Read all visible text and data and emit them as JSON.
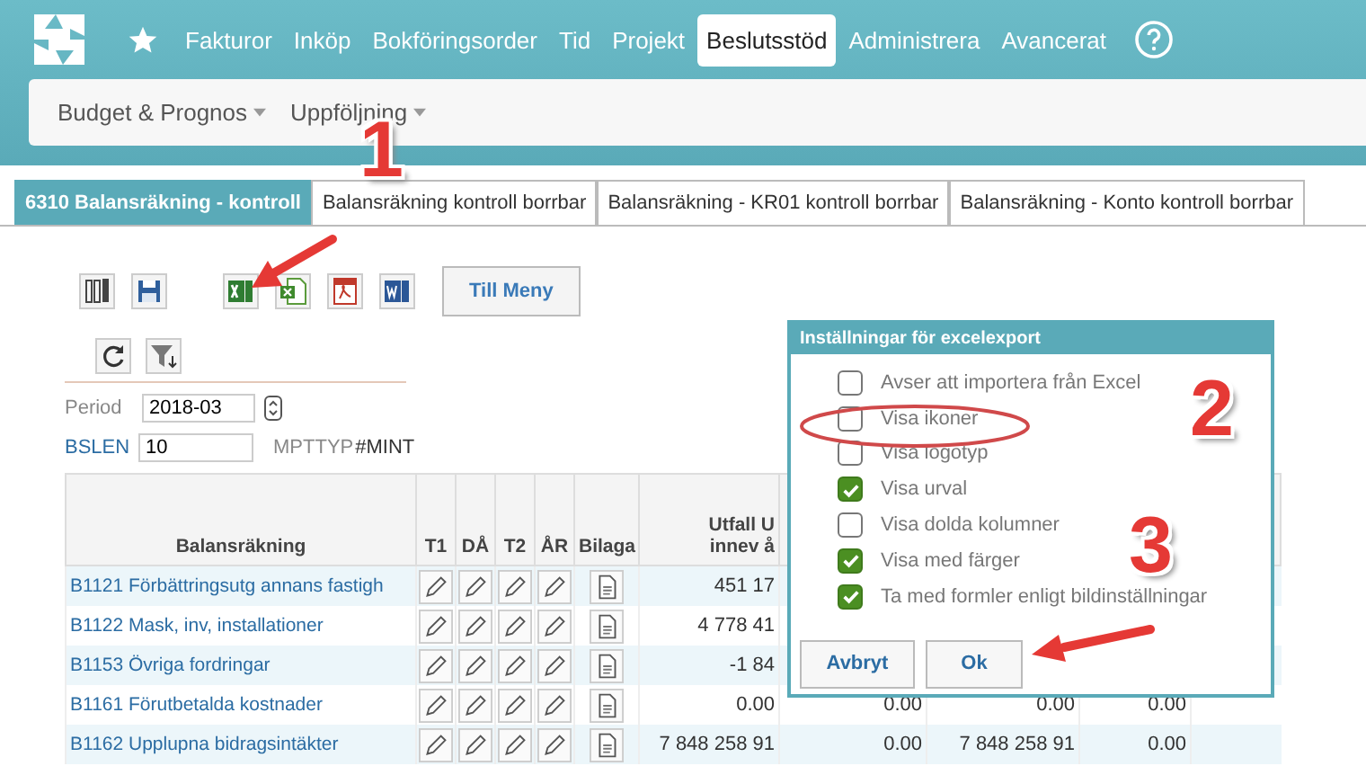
{
  "nav": {
    "items": [
      {
        "label": "Fakturor",
        "selected": false
      },
      {
        "label": "Inköp",
        "selected": false
      },
      {
        "label": "Bokföringsorder",
        "selected": false
      },
      {
        "label": "Tid",
        "selected": false
      },
      {
        "label": "Projekt",
        "selected": false
      },
      {
        "label": "Beslutsstöd",
        "selected": true
      },
      {
        "label": "Administrera",
        "selected": false
      },
      {
        "label": "Avancerat",
        "selected": false
      }
    ]
  },
  "subnav": {
    "items": [
      "Budget & Prognos",
      "Uppföljning"
    ]
  },
  "tabs": [
    {
      "label": "6310 Balansräkning - kontroll",
      "selected": true
    },
    {
      "label": "Balansräkning kontroll borrbar",
      "selected": false
    },
    {
      "label": "Balansräkning - KR01 kontroll borrbar",
      "selected": false
    },
    {
      "label": "Balansräkning - Konto kontroll borrbar",
      "selected": false
    }
  ],
  "toolbar": {
    "menu_button": "Till Meny"
  },
  "filters": {
    "period_label": "Period",
    "period_value": "2018-03",
    "bslen_label": "BSLEN",
    "bslen_value": "10",
    "mpttyp_label": "MPTTYP",
    "mpttyp_value": "#MINT"
  },
  "table": {
    "columns": [
      "Balansräkning",
      "T1",
      "DÅ",
      "T2",
      "ÅR",
      "Bilaga"
    ],
    "column_7": [
      "Utfall U",
      "innev å"
    ],
    "rows": [
      {
        "account": "B1121 Förbättringsutg annans fastigh",
        "values": [
          "451 17"
        ]
      },
      {
        "account": "B1122 Mask, inv, installationer",
        "values": [
          "4 778 41"
        ]
      },
      {
        "account": "B1153 Övriga fordringar",
        "values": [
          "-1 84"
        ]
      },
      {
        "account": "B1161 Förutbetalda kostnader",
        "values": [
          "0.00",
          "0.00",
          "0.00",
          "0.00"
        ]
      },
      {
        "account": "B1162 Upplupna bidragsintäkter",
        "values": [
          "7 848 258 91",
          "0.00",
          "7 848 258 91",
          "0.00"
        ]
      }
    ]
  },
  "dialog": {
    "title": "Inställningar för excelexport",
    "options": [
      {
        "label": "Avser att importera från Excel",
        "checked": false
      },
      {
        "label": "Visa ikoner",
        "checked": false
      },
      {
        "label": "Visa logotyp",
        "checked": false
      },
      {
        "label": "Visa urval",
        "checked": true
      },
      {
        "label": "Visa dolda kolumner",
        "checked": false
      },
      {
        "label": "Visa med färger",
        "checked": true
      },
      {
        "label": "Ta med formler enligt bildinställningar",
        "checked": true
      }
    ],
    "buttons": [
      "Avbryt",
      "Ok"
    ]
  },
  "annotations": {
    "numbers": [
      "1",
      "2",
      "3"
    ]
  }
}
